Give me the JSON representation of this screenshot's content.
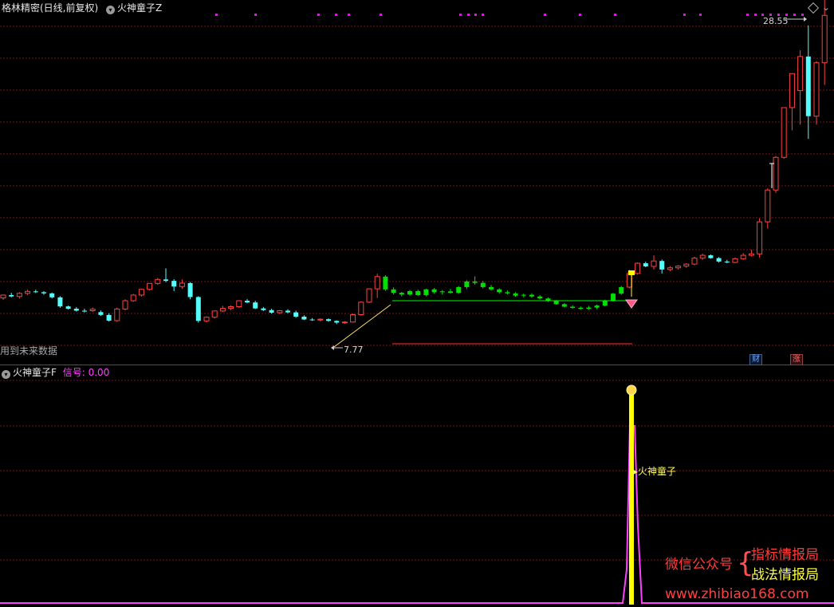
{
  "header": {
    "title": "格林精密(日线,前复权)",
    "indicator_main": "火神童子Z",
    "price_high": "28.55",
    "price_low": "7.77",
    "future_data_note": "用到未来数据"
  },
  "badges": {
    "fin": "财",
    "rise": "涨"
  },
  "sub_panel": {
    "name": "火神童子F",
    "signal_label": "信号:",
    "signal_value": "0.00",
    "signal_text": "火神童子"
  },
  "watermark": {
    "wechat": "微信公众号",
    "brace": "{",
    "line1": "指标情报局",
    "line2": "战法情报局",
    "url": "www.zhibiao168.com"
  },
  "colors": {
    "up": "#ff4040",
    "down_cyan": "#54fcfc",
    "green": "#00e000",
    "grid": "#7a1010",
    "magenta": "#ff00ff",
    "yellow": "#ffff00",
    "signal_magenta": "#ff40ff"
  },
  "candles": [
    [
      0,
      17.0,
      18.2,
      16.3,
      18.0
    ],
    [
      1,
      18.0,
      18.8,
      17.2,
      17.5
    ],
    [
      2,
      17.5,
      19.0,
      16.8,
      18.6
    ],
    [
      3,
      18.6,
      19.9,
      18.0,
      19.3
    ],
    [
      4,
      19.3,
      19.9,
      18.7,
      19.0
    ],
    [
      5,
      19.0,
      19.4,
      18.1,
      18.6
    ],
    [
      6,
      18.6,
      18.9,
      16.8,
      17.2
    ],
    [
      7,
      17.2,
      17.6,
      13.5,
      14.0
    ],
    [
      8,
      14.0,
      14.3,
      12.9,
      13.2
    ],
    [
      9,
      13.2,
      13.8,
      12.2,
      12.5
    ],
    [
      10,
      12.5,
      13.2,
      11.9,
      12.2
    ],
    [
      11,
      12.5,
      13.6,
      12.1,
      13.0
    ],
    [
      12,
      12.0,
      12.6,
      10.7,
      11.0
    ],
    [
      13,
      11.0,
      11.6,
      8.7,
      9.0
    ],
    [
      14,
      9.0,
      13.6,
      8.6,
      13.1
    ],
    [
      15,
      13.1,
      16.5,
      12.6,
      16.0
    ],
    [
      16,
      16.0,
      18.4,
      15.6,
      18.0
    ],
    [
      17,
      18.0,
      20.3,
      17.4,
      20.0
    ],
    [
      18,
      20.0,
      22.2,
      19.6,
      22.1
    ],
    [
      19,
      22.1,
      24.0,
      21.6,
      23.5
    ],
    [
      20,
      23.5,
      27.4,
      22.5,
      23.0
    ],
    [
      21,
      23.0,
      23.6,
      19.4,
      21.0
    ],
    [
      22,
      21.0,
      23.5,
      20.2,
      22.2
    ],
    [
      23,
      22.2,
      22.6,
      16.5,
      17.3
    ],
    [
      24,
      17.3,
      17.6,
      8.3,
      8.9
    ],
    [
      25,
      8.9,
      10.5,
      8.3,
      10.2
    ],
    [
      26,
      10.2,
      12.5,
      9.8,
      12.4
    ],
    [
      27,
      12.4,
      14.2,
      12.0,
      13.3
    ],
    [
      28,
      13.3,
      14.4,
      12.6,
      13.9
    ],
    [
      29,
      13.9,
      16.2,
      13.5,
      16.0
    ],
    [
      30,
      16.0,
      16.6,
      15.1,
      15.4
    ],
    [
      31,
      15.4,
      16.0,
      13.1,
      13.3
    ],
    [
      32,
      13.3,
      13.8,
      12.4,
      12.7
    ],
    [
      33,
      12.7,
      13.2,
      11.5,
      11.8
    ],
    [
      34,
      11.8,
      12.7,
      11.3,
      12.5
    ],
    [
      35,
      12.5,
      13.0,
      11.6,
      11.9
    ],
    [
      36,
      11.9,
      12.5,
      10.0,
      10.4
    ],
    [
      37,
      10.4,
      10.9,
      9.2,
      9.4
    ],
    [
      38,
      9.4,
      9.9,
      8.9,
      9.2
    ],
    [
      39,
      9.2,
      9.8,
      8.7,
      9.5
    ],
    [
      40,
      9.5,
      9.8,
      8.6,
      8.9
    ],
    [
      41,
      8.9,
      9.1,
      7.77,
      8.3
    ],
    [
      42,
      8.3,
      8.8,
      7.9,
      8.5
    ],
    [
      43,
      8.5,
      11.5,
      8.3,
      11.1
    ],
    [
      44,
      11.1,
      15.8,
      10.8,
      15.5
    ],
    [
      45,
      15.5,
      20.4,
      15.2,
      20.2
    ],
    [
      46,
      20.2,
      25.5,
      17.0,
      24.5
    ],
    [
      47,
      24.5,
      25.0,
      19.5,
      20.0
    ],
    [
      48,
      20.0,
      20.7,
      18.2,
      18.8
    ],
    [
      49,
      18.8,
      19.1,
      17.5,
      18.2
    ],
    [
      50,
      18.2,
      19.8,
      17.8,
      19.4
    ],
    [
      51,
      19.4,
      19.9,
      17.7,
      18.0
    ],
    [
      52,
      18.0,
      20.2,
      17.6,
      20.0
    ],
    [
      53,
      20.0,
      20.5,
      18.5,
      19.0
    ],
    [
      54,
      19.0,
      19.8,
      18.2,
      19.3
    ],
    [
      55,
      19.3,
      20.2,
      18.5,
      18.8
    ],
    [
      56,
      18.8,
      21.2,
      18.4,
      20.8
    ],
    [
      57,
      20.8,
      23.2,
      20.1,
      22.8
    ],
    [
      58,
      22.8,
      24.6,
      21.6,
      22.3
    ],
    [
      59,
      22.3,
      23.0,
      20.3,
      20.8
    ],
    [
      60,
      20.8,
      21.6,
      19.6,
      20.0
    ],
    [
      61,
      20.0,
      20.4,
      18.5,
      19.0
    ],
    [
      62,
      19.0,
      19.6,
      18.2,
      18.6
    ],
    [
      63,
      18.6,
      19.0,
      17.4,
      17.8
    ],
    [
      64,
      17.8,
      18.5,
      17.2,
      18.1
    ],
    [
      65,
      18.1,
      18.6,
      17.0,
      17.5
    ],
    [
      66,
      17.5,
      18.0,
      16.4,
      16.8
    ],
    [
      67,
      16.8,
      17.2,
      15.6,
      15.9
    ],
    [
      68,
      15.9,
      16.2,
      14.6,
      14.8
    ],
    [
      69,
      14.8,
      15.2,
      13.7,
      13.9
    ],
    [
      70,
      13.9,
      14.4,
      13.2,
      13.5
    ],
    [
      71,
      13.5,
      14.0,
      12.8,
      13.2
    ],
    [
      72,
      13.2,
      14.2,
      12.8,
      13.6
    ],
    [
      73,
      13.6,
      14.6,
      13.0,
      14.3
    ],
    [
      74,
      14.3,
      16.4,
      14.0,
      16.0
    ],
    [
      75,
      16.0,
      18.8,
      15.7,
      18.5
    ],
    [
      76,
      18.5,
      21.2,
      18.1,
      20.8
    ],
    [
      77,
      20.8,
      26.9,
      20.4,
      25.6
    ],
    [
      78,
      25.6,
      29.5,
      25.2,
      29.2
    ],
    [
      79,
      29.2,
      29.8,
      27.8,
      28.1
    ],
    [
      80,
      28.1,
      32.0,
      27.0,
      30.0
    ],
    [
      81,
      30.0,
      30.5,
      25.6,
      27.0
    ],
    [
      82,
      27.0,
      28.2,
      26.4,
      27.6
    ],
    [
      83,
      27.6,
      28.5,
      27.0,
      28.2
    ],
    [
      84,
      28.2,
      29.2,
      27.6,
      28.9
    ],
    [
      85,
      28.9,
      31.5,
      28.5,
      31.0
    ],
    [
      86,
      31.0,
      32.6,
      30.4,
      32.0
    ],
    [
      87,
      32.0,
      32.3,
      30.8,
      31.0
    ],
    [
      88,
      31.0,
      31.4,
      29.4,
      29.8
    ],
    [
      89,
      29.8,
      30.4,
      29.2,
      29.5
    ],
    [
      90,
      29.5,
      31.2,
      29.2,
      30.8
    ],
    [
      91,
      30.8,
      32.8,
      30.5,
      32.0
    ],
    [
      92,
      32.0,
      34.0,
      31.6,
      32.5
    ],
    [
      93,
      32.5,
      45.0,
      31.2,
      43.8
    ],
    [
      94,
      43.8,
      55.6,
      41.4,
      55.0
    ],
    [
      95,
      55.0,
      67.0,
      54.0,
      66.5
    ],
    [
      96,
      66.5,
      84.0,
      66.0,
      84.0
    ],
    [
      97,
      84.0,
      94.0,
      76.0,
      96.0
    ],
    [
      98,
      90.0,
      104.2,
      78.0,
      102.0
    ],
    [
      99,
      102.0,
      113.0,
      73.0,
      81.0
    ],
    [
      100,
      81.0,
      100.4,
      78.0,
      99.8
    ],
    [
      101,
      99.8,
      125.0,
      92.0,
      116.5
    ]
  ]
}
